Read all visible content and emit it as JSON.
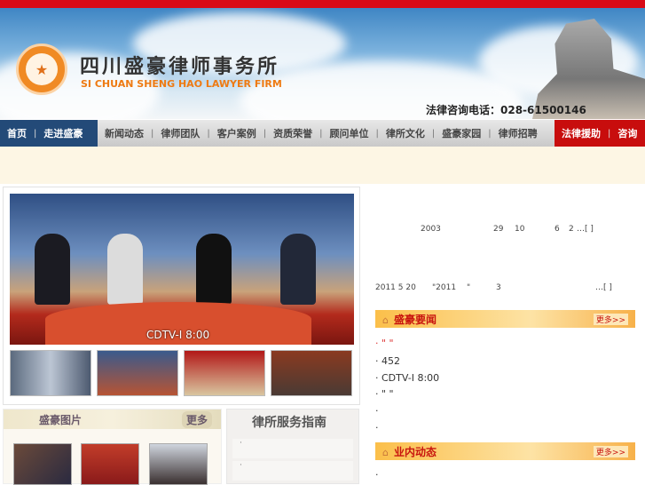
{
  "header": {
    "title_cn": "四川盛豪律师事务所",
    "title_en": "SI CHUAN SHENG HAO LAWYER FIRM",
    "phone": "法律咨询电话：028-61500146"
  },
  "nav": {
    "left": [
      "首页",
      "走进盛豪"
    ],
    "middle": [
      "新闻动态",
      "律师团队",
      "客户案例",
      "资质荣誉",
      "顾问单位",
      "律所文化",
      "盛豪家园",
      "律师招聘"
    ],
    "right": [
      "法律援助",
      "咨询"
    ]
  },
  "video": {
    "caption": "CDTV-I  8:00"
  },
  "intro": {
    "line1_year": "2003",
    "line1_a": "29",
    "line1_b": "10",
    "line1_c": "6",
    "line1_d": "2",
    "line1_more": "…[ ]",
    "line2_date": "2011 5 20",
    "line2_quote": "\"2011",
    "line2_mark": "\"",
    "line2_num": "3",
    "line2_more": "…[ ]"
  },
  "news": {
    "title": "盛豪要闻",
    "more": "更多>>",
    "items": [
      "·    \"      \"",
      "·  452",
      "·      CDTV-I  8:00",
      "·  \" \"",
      "·",
      "·"
    ]
  },
  "industry": {
    "title": "业内动态",
    "more": "更多>>",
    "items": [
      "·"
    ]
  },
  "photos": {
    "title": "盛豪图片",
    "more": "更多"
  },
  "guide": {
    "title": "律所服务指南",
    "items": [
      "·",
      "·"
    ]
  }
}
